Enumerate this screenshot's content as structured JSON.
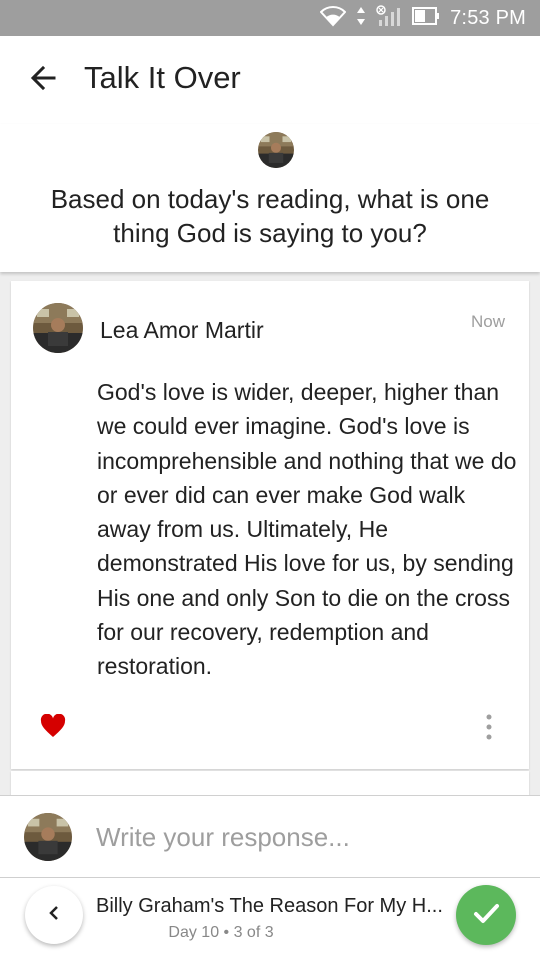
{
  "status_bar": {
    "time": "7:53 PM",
    "icons": [
      "wifi-icon",
      "data-arrows-icon",
      "signal-icon",
      "battery-icon"
    ]
  },
  "app_bar": {
    "title": "Talk It Over",
    "back_icon": "arrow-left-icon"
  },
  "question": {
    "text": "Based on today's reading, what is one thing God is saying to you?"
  },
  "comment": {
    "author": "Lea Amor Martir",
    "time": "Now",
    "body": "God's love is wider, deeper, higher than we could ever imagine. God's love is incomprehensible and nothing that we do or ever did can ever make God walk away from us. Ultimately, He demonstrated His love for us, by sending His one and only Son to die on the cross for our recovery, redemption and restoration.",
    "liked": true,
    "like_icon": "heart-icon",
    "menu_icon": "more-vertical-icon"
  },
  "composer": {
    "placeholder": "Write your response..."
  },
  "plan_bar": {
    "title": "Billy Graham's The Reason For My H...",
    "progress": "Day 10 • 3 of 3",
    "prev_icon": "chevron-left-icon",
    "done_icon": "check-icon"
  },
  "colors": {
    "status_bar": "#9e9e9e",
    "like": "#d50000",
    "done": "#5cb85c",
    "muted": "#9e9e9e"
  }
}
